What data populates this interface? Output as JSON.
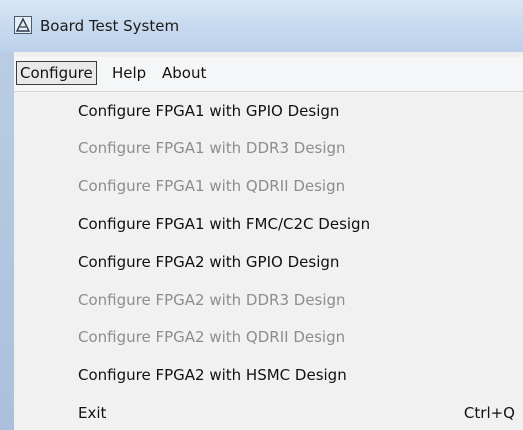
{
  "window": {
    "title": "Board Test System"
  },
  "menubar": {
    "items": [
      {
        "label": "Configure"
      },
      {
        "label": "Help"
      },
      {
        "label": "About"
      }
    ]
  },
  "dropdown": {
    "items": [
      {
        "label": "Configure FPGA1 with GPIO Design",
        "enabled": true,
        "shortcut": ""
      },
      {
        "label": "Configure FPGA1 with DDR3 Design",
        "enabled": false,
        "shortcut": ""
      },
      {
        "label": "Configure FPGA1 with QDRII Design",
        "enabled": false,
        "shortcut": ""
      },
      {
        "label": "Configure FPGA1 with FMC/C2C Design",
        "enabled": true,
        "shortcut": ""
      },
      {
        "label": "Configure FPGA2 with GPIO Design",
        "enabled": true,
        "shortcut": ""
      },
      {
        "label": "Configure FPGA2 with DDR3 Design",
        "enabled": false,
        "shortcut": ""
      },
      {
        "label": "Configure FPGA2 with QDRII Design",
        "enabled": false,
        "shortcut": ""
      },
      {
        "label": "Configure FPGA2 with HSMC Design",
        "enabled": true,
        "shortcut": ""
      },
      {
        "label": "Exit",
        "enabled": true,
        "shortcut": "Ctrl+Q"
      }
    ]
  },
  "colors": {
    "enabled_text": "#111111",
    "disabled_text": "#8d8d8d",
    "titlebar": "#c6d9ef"
  },
  "icons": {
    "app": "app-logo-icon"
  }
}
